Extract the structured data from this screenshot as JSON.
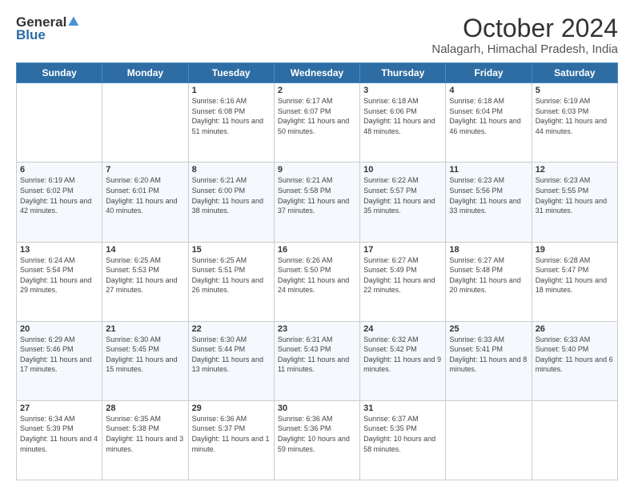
{
  "header": {
    "logo_general": "General",
    "logo_blue": "Blue",
    "month": "October 2024",
    "location": "Nalagarh, Himachal Pradesh, India"
  },
  "weekdays": [
    "Sunday",
    "Monday",
    "Tuesday",
    "Wednesday",
    "Thursday",
    "Friday",
    "Saturday"
  ],
  "weeks": [
    [
      {
        "day": "",
        "info": ""
      },
      {
        "day": "",
        "info": ""
      },
      {
        "day": "1",
        "info": "Sunrise: 6:16 AM\nSunset: 6:08 PM\nDaylight: 11 hours and 51 minutes."
      },
      {
        "day": "2",
        "info": "Sunrise: 6:17 AM\nSunset: 6:07 PM\nDaylight: 11 hours and 50 minutes."
      },
      {
        "day": "3",
        "info": "Sunrise: 6:18 AM\nSunset: 6:06 PM\nDaylight: 11 hours and 48 minutes."
      },
      {
        "day": "4",
        "info": "Sunrise: 6:18 AM\nSunset: 6:04 PM\nDaylight: 11 hours and 46 minutes."
      },
      {
        "day": "5",
        "info": "Sunrise: 6:19 AM\nSunset: 6:03 PM\nDaylight: 11 hours and 44 minutes."
      }
    ],
    [
      {
        "day": "6",
        "info": "Sunrise: 6:19 AM\nSunset: 6:02 PM\nDaylight: 11 hours and 42 minutes."
      },
      {
        "day": "7",
        "info": "Sunrise: 6:20 AM\nSunset: 6:01 PM\nDaylight: 11 hours and 40 minutes."
      },
      {
        "day": "8",
        "info": "Sunrise: 6:21 AM\nSunset: 6:00 PM\nDaylight: 11 hours and 38 minutes."
      },
      {
        "day": "9",
        "info": "Sunrise: 6:21 AM\nSunset: 5:58 PM\nDaylight: 11 hours and 37 minutes."
      },
      {
        "day": "10",
        "info": "Sunrise: 6:22 AM\nSunset: 5:57 PM\nDaylight: 11 hours and 35 minutes."
      },
      {
        "day": "11",
        "info": "Sunrise: 6:23 AM\nSunset: 5:56 PM\nDaylight: 11 hours and 33 minutes."
      },
      {
        "day": "12",
        "info": "Sunrise: 6:23 AM\nSunset: 5:55 PM\nDaylight: 11 hours and 31 minutes."
      }
    ],
    [
      {
        "day": "13",
        "info": "Sunrise: 6:24 AM\nSunset: 5:54 PM\nDaylight: 11 hours and 29 minutes."
      },
      {
        "day": "14",
        "info": "Sunrise: 6:25 AM\nSunset: 5:53 PM\nDaylight: 11 hours and 27 minutes."
      },
      {
        "day": "15",
        "info": "Sunrise: 6:25 AM\nSunset: 5:51 PM\nDaylight: 11 hours and 26 minutes."
      },
      {
        "day": "16",
        "info": "Sunrise: 6:26 AM\nSunset: 5:50 PM\nDaylight: 11 hours and 24 minutes."
      },
      {
        "day": "17",
        "info": "Sunrise: 6:27 AM\nSunset: 5:49 PM\nDaylight: 11 hours and 22 minutes."
      },
      {
        "day": "18",
        "info": "Sunrise: 6:27 AM\nSunset: 5:48 PM\nDaylight: 11 hours and 20 minutes."
      },
      {
        "day": "19",
        "info": "Sunrise: 6:28 AM\nSunset: 5:47 PM\nDaylight: 11 hours and 18 minutes."
      }
    ],
    [
      {
        "day": "20",
        "info": "Sunrise: 6:29 AM\nSunset: 5:46 PM\nDaylight: 11 hours and 17 minutes."
      },
      {
        "day": "21",
        "info": "Sunrise: 6:30 AM\nSunset: 5:45 PM\nDaylight: 11 hours and 15 minutes."
      },
      {
        "day": "22",
        "info": "Sunrise: 6:30 AM\nSunset: 5:44 PM\nDaylight: 11 hours and 13 minutes."
      },
      {
        "day": "23",
        "info": "Sunrise: 6:31 AM\nSunset: 5:43 PM\nDaylight: 11 hours and 11 minutes."
      },
      {
        "day": "24",
        "info": "Sunrise: 6:32 AM\nSunset: 5:42 PM\nDaylight: 11 hours and 9 minutes."
      },
      {
        "day": "25",
        "info": "Sunrise: 6:33 AM\nSunset: 5:41 PM\nDaylight: 11 hours and 8 minutes."
      },
      {
        "day": "26",
        "info": "Sunrise: 6:33 AM\nSunset: 5:40 PM\nDaylight: 11 hours and 6 minutes."
      }
    ],
    [
      {
        "day": "27",
        "info": "Sunrise: 6:34 AM\nSunset: 5:39 PM\nDaylight: 11 hours and 4 minutes."
      },
      {
        "day": "28",
        "info": "Sunrise: 6:35 AM\nSunset: 5:38 PM\nDaylight: 11 hours and 3 minutes."
      },
      {
        "day": "29",
        "info": "Sunrise: 6:36 AM\nSunset: 5:37 PM\nDaylight: 11 hours and 1 minute."
      },
      {
        "day": "30",
        "info": "Sunrise: 6:36 AM\nSunset: 5:36 PM\nDaylight: 10 hours and 59 minutes."
      },
      {
        "day": "31",
        "info": "Sunrise: 6:37 AM\nSunset: 5:35 PM\nDaylight: 10 hours and 58 minutes."
      },
      {
        "day": "",
        "info": ""
      },
      {
        "day": "",
        "info": ""
      }
    ]
  ]
}
